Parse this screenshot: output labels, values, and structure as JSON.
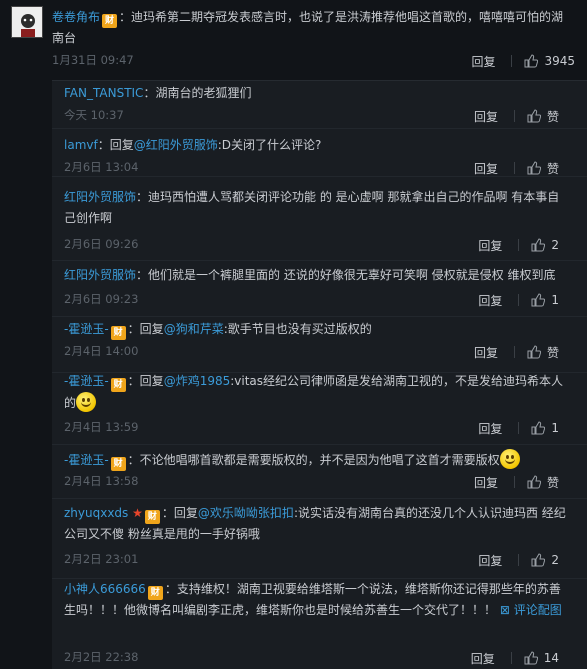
{
  "top_comment": {
    "username": "卷卷角布",
    "badge": "财",
    "text": "：迪玛希第二期夺冠发表感言时，也说了是洪涛推荐他唱这首歌的，嘻嘻嘻可怕的湖南台",
    "time": "1月31日 09:47",
    "reply_label": "回复",
    "likes": "3945"
  },
  "replies": [
    {
      "user": "FAN_TANSTIC",
      "text": "：湖南台的老狐狸们",
      "time": "今天 10:37",
      "reply_label": "回复",
      "likes": "赞"
    },
    {
      "user": "lamvf",
      "pre": "：回复",
      "mention": "@红阳外贸服饰",
      "text": ":D关闭了什么评论?",
      "time": "2月6日 13:04",
      "reply_label": "回复",
      "likes": "赞"
    },
    {
      "user": "红阳外贸服饰",
      "text": "：迪玛西怕遭人骂都关闭评论功能 的 是心虚啊 那就拿出自己的作品啊 有本事自己创作啊",
      "time": "2月6日 09:26",
      "reply_label": "回复",
      "likes": "2"
    },
    {
      "user": "红阳外贸服饰",
      "text": "：他们就是一个裤腿里面的 还说的好像很无辜好可笑啊 侵权就是侵权 维权到底",
      "time": "2月6日 09:23",
      "reply_label": "回复",
      "likes": "1"
    },
    {
      "user": "-霍逊玉-",
      "badge": "财",
      "pre": "：回复",
      "mention": "@狗和芹菜",
      "text": ":歌手节目也没有买过版权的",
      "time": "2月4日 14:00",
      "reply_label": "回复",
      "likes": "赞"
    },
    {
      "user": "-霍逊玉-",
      "badge": "财",
      "pre": "：回复",
      "mention": "@炸鸡1985",
      "text": ":vitas经纪公司律师函是发给湖南卫视的，不是发给迪玛希本人的",
      "time": "2月4日 13:59",
      "reply_label": "回复",
      "likes": "1"
    },
    {
      "user": "-霍逊玉-",
      "badge": "财",
      "text": "：不论他唱哪首歌都是需要版权的，并不是因为他唱了这首才需要版权",
      "time": "2月4日 13:58",
      "reply_label": "回复",
      "likes": "赞"
    },
    {
      "user": "zhyuqxxds",
      "badge": "财",
      "pre": "：回复",
      "mention": "@欢乐呦呦张扣扣",
      "text": ":说实话没有湖南台真的还没几个人认识迪玛西  经纪公司又不傻  粉丝真是甩的一手好锅哦",
      "time": "2月2日 23:01",
      "reply_label": "回复",
      "likes": "2"
    },
    {
      "user": "小神人666666",
      "badge": "财",
      "text": "：支持维权！湖南卫视要给维塔斯一个说法，维塔斯你还记得那些年的苏善生吗！！！他微博名叫编剧李正虎，维塔斯你也是时候给苏善生一个交代了！！！",
      "pic_link": "评论配图",
      "time": "2月2日 22:38",
      "reply_label": "回复",
      "likes": "14"
    }
  ]
}
